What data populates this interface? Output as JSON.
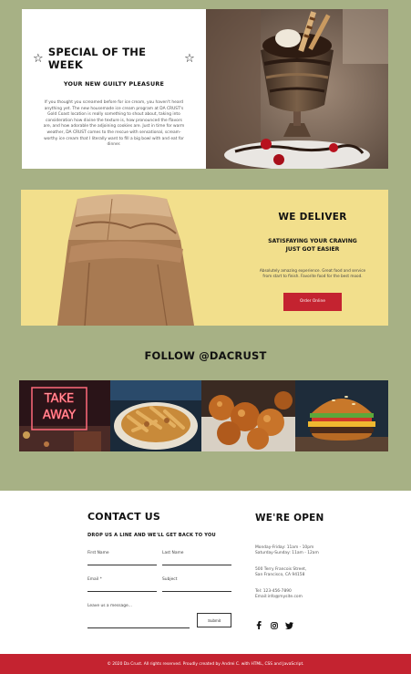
{
  "special": {
    "title": "SPECIAL OF THE WEEK",
    "subtitle": "YOUR NEW GUILTY PLEASURE",
    "body": "If you thought you screamed before for ice cream, you haven't heard anything yet. The new housemade ice cream program at DA CRUST's Gold Coast location is really something to shout about, taking into consideration how divine the texture is, how pronounced the flavors are, and how adorable the adjoining cookies are. Just in time for warm weather, DA CRUST comes to the rescue with sensational, scream-worthy ice cream that I literally want to fill a big bowl with and eat for dinner."
  },
  "deliver": {
    "title": "WE DELIVER",
    "subtitle": "SATISFAYING YOUR CRAVING JUST GOT EASIER",
    "body": "Absolutely amazing experience. Great food and service from start to finish. Favorite food for the best mood.",
    "button": "Order Online"
  },
  "follow": {
    "title": "FOLLOW @DACRUST",
    "neon_sign": [
      "TAKE",
      "AWAY"
    ]
  },
  "contact": {
    "title": "CONTACT US",
    "subtitle": "DROP US A LINE AND WE'LL GET BACK TO YOU",
    "first_name": "First Name",
    "last_name": "Last Name",
    "email": "Email *",
    "subject": "Subject",
    "message": "Leave us a message...",
    "submit": "Submit"
  },
  "open": {
    "title": "WE'RE OPEN",
    "hours_weekday": "Monday-Friday: 11am - 10pm",
    "hours_weekend": "Saturday-Sunday: 11am - 12am",
    "address_line1": "500 Terry Francois Street,",
    "address_line2": "San Francisco, CA 94158",
    "phone": "Tel: 123-456-7890",
    "email": "Email:info@mysite.com"
  },
  "footer": {
    "text": "© 2020 Da Crust. All rights reserved. Proudly created by Andrei C. with HTML, CSS and JavaScript."
  },
  "colors": {
    "background": "#a7b185",
    "accent": "#c42330",
    "deliver_bg": "#f2df8c"
  }
}
